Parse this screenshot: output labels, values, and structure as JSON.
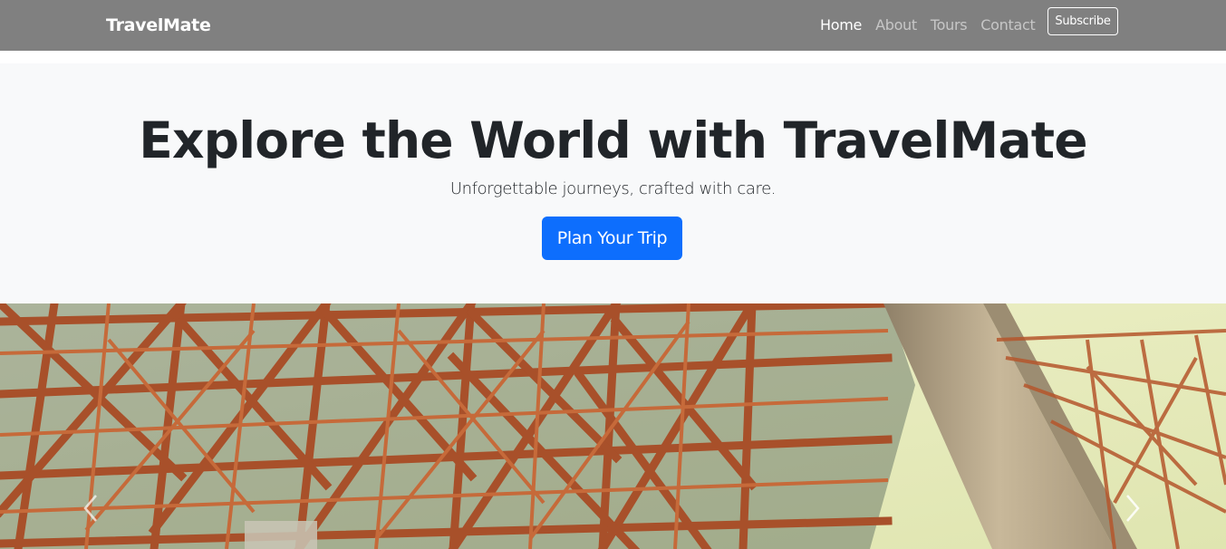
{
  "navbar": {
    "brand": "TravelMate",
    "links": [
      {
        "label": "Home",
        "active": true
      },
      {
        "label": "About",
        "active": false
      },
      {
        "label": "Tours",
        "active": false
      },
      {
        "label": "Contact",
        "active": false
      }
    ],
    "subscribe_label": "Subscribe"
  },
  "hero": {
    "title": "Explore the World with TravelMate",
    "subtitle": "Unforgettable journeys, crafted with care.",
    "cta_label": "Plan Your Trip"
  },
  "carousel": {
    "prev_icon": "chevron-left-icon",
    "next_icon": "chevron-right-icon"
  },
  "colors": {
    "navbar_bg": "#808080",
    "hero_bg": "#f8f9fa",
    "primary": "#0d6efd",
    "text_dark": "#212529",
    "steel": "#b5562c",
    "sky": "#e8edbe",
    "shadow": "#1e3a3c"
  }
}
